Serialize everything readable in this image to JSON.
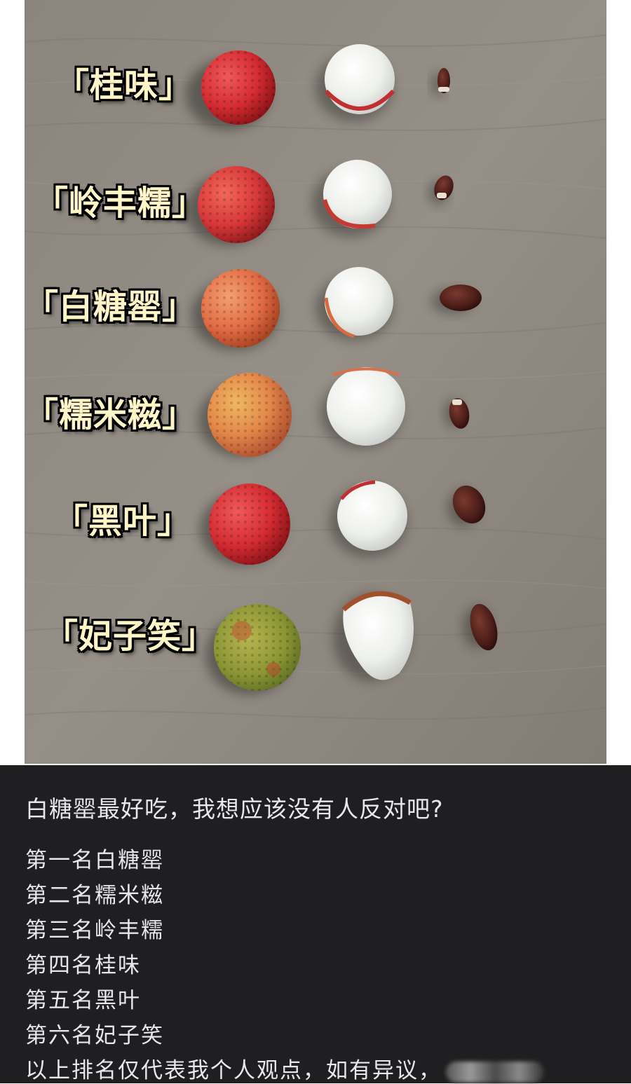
{
  "labels": {
    "guiwei": "「桂味」",
    "lingfengnuo": "「岭丰糯」",
    "baitangying": "「白糖罂」",
    "nuomici": "「糯米糍」",
    "heiye": "「黑叶」",
    "feizixiao": "「妃子笑」"
  },
  "caption": {
    "title": "白糖罂最好吃，我想应该没有人反对吧?",
    "lines": [
      "第一名白糖罂",
      "第二名糯米糍",
      "第三名岭丰糯",
      "第四名桂味",
      "第五名黑叶",
      "第六名妃子笑",
      "以上排名仅代表我个人观点，如有异议，"
    ]
  },
  "colors": {
    "caption_bg": "#1f1f21",
    "caption_text": "#e8e8ea",
    "label_fill": "#fff6c8",
    "table_wood": "#8e8880"
  }
}
